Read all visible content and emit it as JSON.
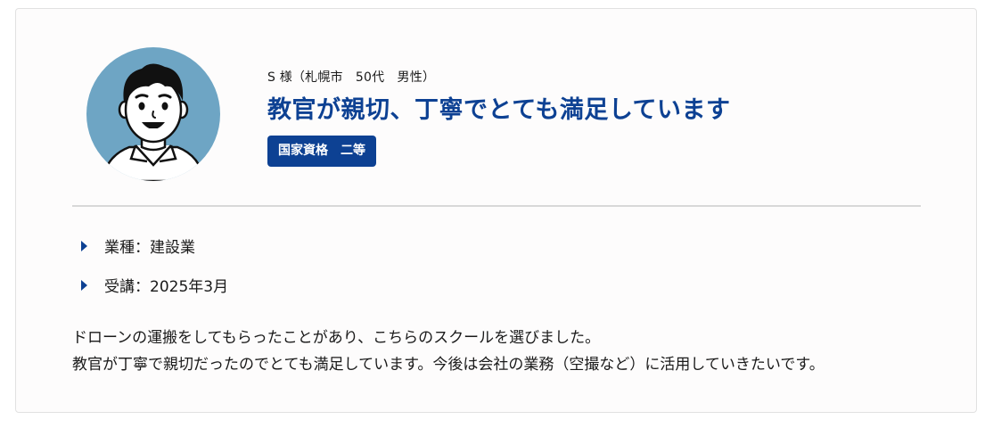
{
  "review": {
    "reviewer_meta": "S 様（札幌市　50代　男性）",
    "title": "教官が親切、丁寧でとても満足しています",
    "badge": "国家資格　二等",
    "details": [
      {
        "label": "業種：建設業"
      },
      {
        "label": "受講：2025年3月"
      }
    ],
    "body_lines": [
      "ドローンの運搬をしてもらったことがあり、こちらのスクールを選びました。",
      "教官が丁寧で親切だったのでとても満足しています。今後は会社の業務（空撮など）に活用していきたいです。"
    ]
  },
  "colors": {
    "accent": "#0d4193",
    "avatar_bg": "#6ea5c4",
    "divider": "#d8d8d8",
    "text": "#1a1a1a"
  },
  "icons": {
    "avatar": "male-avatar-illustration",
    "list_marker": "triangle-right-icon"
  }
}
